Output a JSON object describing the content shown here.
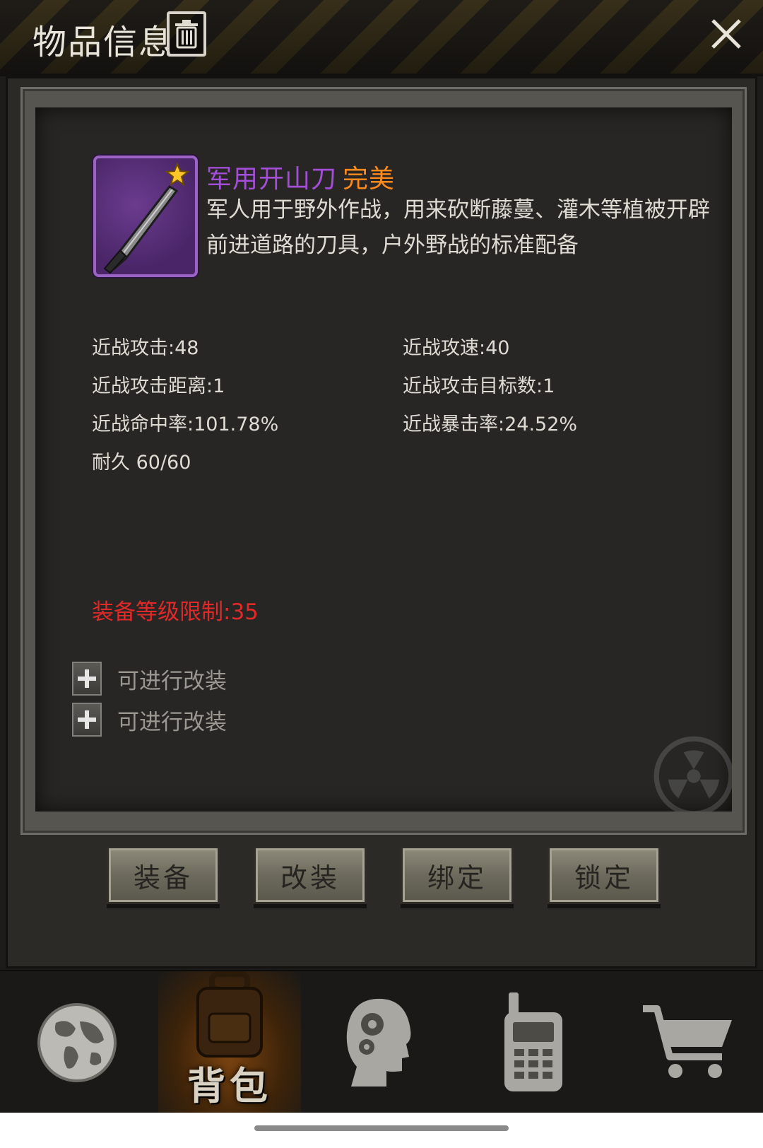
{
  "header": {
    "title": "物品信息",
    "trash_icon": "trash-icon",
    "close_icon": "close-icon"
  },
  "item": {
    "name": "军用开山刀",
    "quality": "完美",
    "name_color": "#a34ed6",
    "quality_color": "#ff8a1c",
    "description": "军人用于野外作战，用来砍断藤蔓、灌木等植被开辟前进道路的刀具，户外野战的标准配备",
    "icon": "machete-icon",
    "badge_icon": "star-icon"
  },
  "stats": [
    {
      "left": "近战攻击:48",
      "right": "近战攻速:40"
    },
    {
      "left": "近战攻击距离:1",
      "right": "近战攻击目标数:1"
    },
    {
      "left": "近战命中率:101.78%",
      "right": "近战暴击率:24.52%"
    },
    {
      "left": "耐久 60/60",
      "right": ""
    }
  ],
  "requirement": {
    "text": "装备等级限制:35",
    "color": "#e02a2a"
  },
  "mods": [
    {
      "label": "可进行改装"
    },
    {
      "label": "可进行改装"
    }
  ],
  "actions": {
    "equip": "装备",
    "modify": "改装",
    "bind": "绑定",
    "lock": "锁定"
  },
  "bottom_nav": {
    "items": [
      {
        "icon": "globe-icon",
        "label": ""
      },
      {
        "icon": "backpack-icon",
        "label": "背包",
        "active": true
      },
      {
        "icon": "head-gears-icon",
        "label": ""
      },
      {
        "icon": "walkie-talkie-icon",
        "label": ""
      },
      {
        "icon": "shopping-cart-icon",
        "label": ""
      }
    ]
  }
}
